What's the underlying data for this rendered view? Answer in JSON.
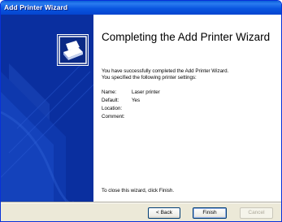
{
  "window": {
    "title": "Add Printer Wizard"
  },
  "content": {
    "heading": "Completing the Add Printer Wizard",
    "desc_line1": "You have successfully completed the Add Printer Wizard.",
    "desc_line2": "You specified the following printer settings:",
    "settings": [
      {
        "label": "Name:",
        "value": "Laser printer"
      },
      {
        "label": "Default:",
        "value": "Yes"
      },
      {
        "label": "Location:",
        "value": ""
      },
      {
        "label": "Comment:",
        "value": ""
      }
    ],
    "closing": "To close this wizard, click Finish."
  },
  "buttons": {
    "back": "< Back",
    "finish": "Finish",
    "cancel": "Cancel"
  },
  "colors": {
    "titlebar": "#0a5fd9",
    "sidebar": "#0a2f9f",
    "dialog": "#ece9d8"
  },
  "icons": {
    "wizard": "printer-icon"
  }
}
